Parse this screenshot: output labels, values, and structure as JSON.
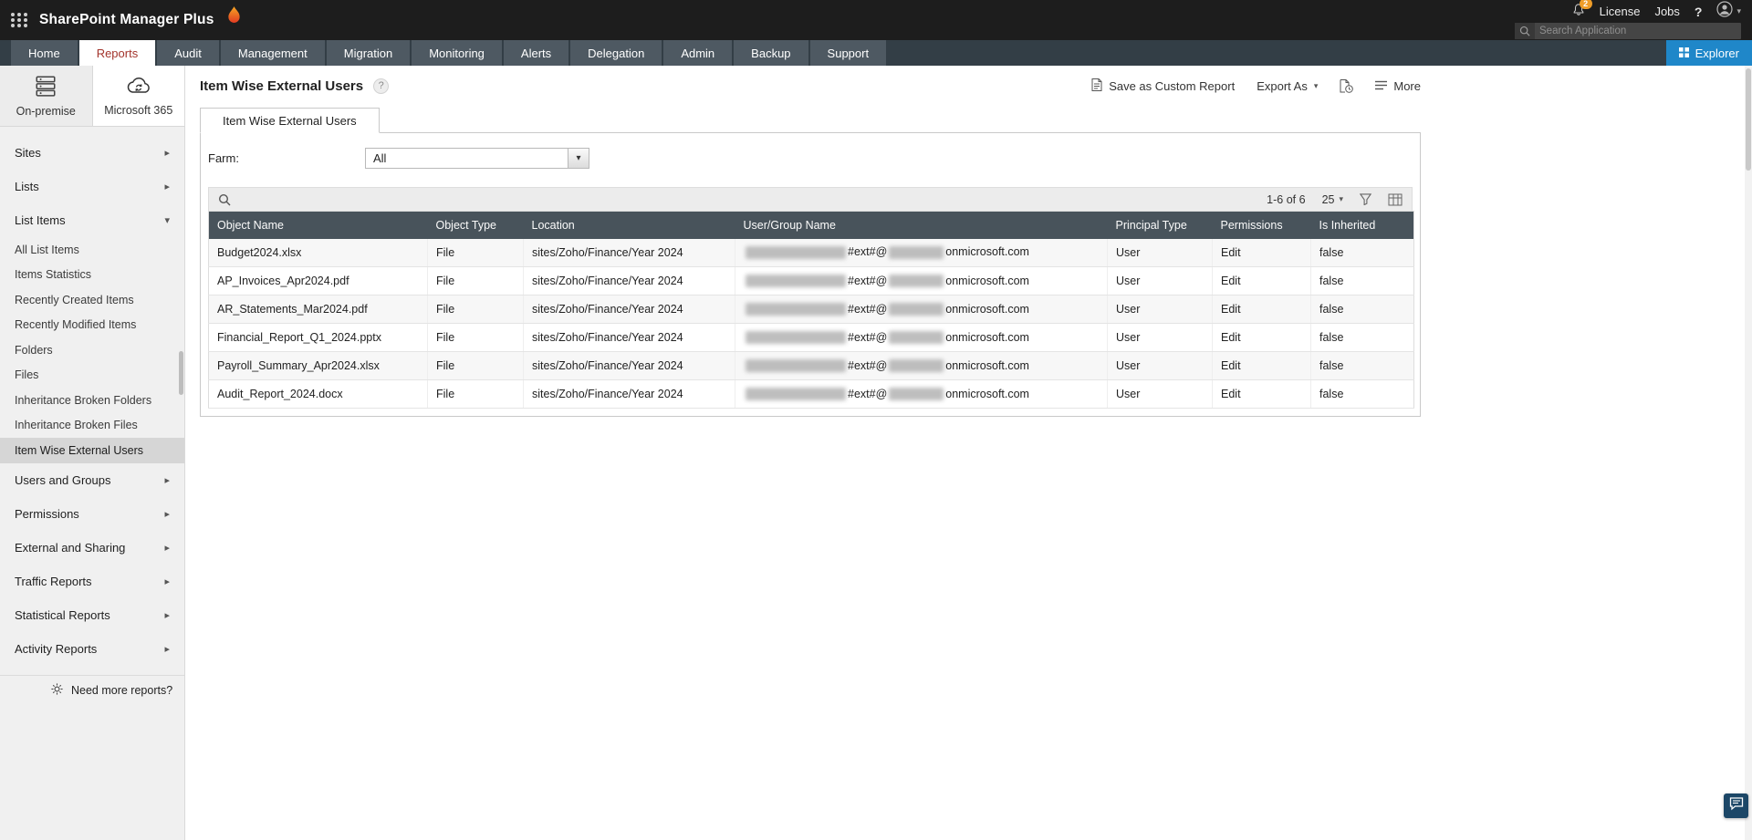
{
  "colors": {
    "topbar_bg": "#1d1d1d",
    "navbar_bg": "#333e46",
    "active_tab_red": "#a3342c",
    "explorer_blue": "#1f87c9",
    "table_header_slate": "#48535b",
    "badge_orange": "#ef9d28",
    "sidebar_bg": "#f0f0f0"
  },
  "topbar": {
    "product_name": "SharePoint Manager Plus",
    "notification_count": "2",
    "license_label": "License",
    "jobs_label": "Jobs",
    "help_label": "?",
    "search_placeholder": "Search Application"
  },
  "nav": {
    "tabs": [
      {
        "name": "tab-home",
        "label": "Home"
      },
      {
        "name": "tab-reports",
        "label": "Reports",
        "state": "active"
      },
      {
        "name": "tab-audit",
        "label": "Audit"
      },
      {
        "name": "tab-management",
        "label": "Management"
      },
      {
        "name": "tab-migration",
        "label": "Migration"
      },
      {
        "name": "tab-monitoring",
        "label": "Monitoring"
      },
      {
        "name": "tab-alerts",
        "label": "Alerts"
      },
      {
        "name": "tab-delegation",
        "label": "Delegation"
      },
      {
        "name": "tab-admin",
        "label": "Admin"
      },
      {
        "name": "tab-backup",
        "label": "Backup"
      },
      {
        "name": "tab-support",
        "label": "Support"
      }
    ],
    "explorer_label": "Explorer"
  },
  "sidebar": {
    "sources": [
      {
        "label": "On-premise"
      },
      {
        "label": "Microsoft 365"
      }
    ],
    "items": [
      {
        "name": "sidebar-item-sites",
        "type": "section",
        "label": "Sites",
        "caret": "▸"
      },
      {
        "name": "sidebar-item-lists",
        "type": "section",
        "label": "Lists",
        "caret": "▸"
      },
      {
        "name": "sidebar-item-list-items",
        "type": "section",
        "label": "List Items",
        "caret": "▾",
        "state": "expanded"
      },
      {
        "name": "sidebar-item-all-list-items",
        "type": "child",
        "label": "All List Items"
      },
      {
        "name": "sidebar-item-items-statistics",
        "type": "child",
        "label": "Items Statistics"
      },
      {
        "name": "sidebar-item-recently-created-items",
        "type": "child",
        "label": "Recently Created Items"
      },
      {
        "name": "sidebar-item-recently-modified-items",
        "type": "child",
        "label": "Recently Modified Items"
      },
      {
        "name": "sidebar-item-folders",
        "type": "child",
        "label": "Folders"
      },
      {
        "name": "sidebar-item-files",
        "type": "child",
        "label": "Files"
      },
      {
        "name": "sidebar-item-inheritance-broken-folders",
        "type": "child",
        "label": "Inheritance Broken Folders"
      },
      {
        "name": "sidebar-item-inheritance-broken-files",
        "type": "child",
        "label": "Inheritance Broken Files"
      },
      {
        "name": "sidebar-item-item-wise-external-users",
        "type": "child",
        "label": "Item Wise External Users",
        "state": "selected"
      },
      {
        "name": "sidebar-item-users-and-groups",
        "type": "section",
        "label": "Users and Groups",
        "caret": "▸"
      },
      {
        "name": "sidebar-item-permissions",
        "type": "section",
        "label": "Permissions",
        "caret": "▸"
      },
      {
        "name": "sidebar-item-external-and-sharing",
        "type": "section",
        "label": "External and Sharing",
        "caret": "▸"
      },
      {
        "name": "sidebar-item-traffic-reports",
        "type": "section",
        "label": "Traffic Reports",
        "caret": "▸"
      },
      {
        "name": "sidebar-item-statistical-reports",
        "type": "section",
        "label": "Statistical Reports",
        "caret": "▸"
      },
      {
        "name": "sidebar-item-activity-reports",
        "type": "section",
        "label": "Activity Reports",
        "caret": "▸"
      }
    ],
    "footer_label": "Need more reports?"
  },
  "content": {
    "title": "Item Wise External Users",
    "actions": {
      "save_as_custom_report": "Save as Custom Report",
      "export_as": "Export As",
      "more": "More"
    },
    "tab_label": "Item Wise External Users",
    "farm": {
      "label": "Farm:",
      "value": "All"
    },
    "toolbar": {
      "range": "1-6 of 6",
      "page_size": "25"
    },
    "table": {
      "columns": [
        "Object Name",
        "Object Type",
        "Location",
        "User/Group Name",
        "Principal Type",
        "Permissions",
        "Is Inherited"
      ],
      "rows": [
        {
          "object_name": "Budget2024.xlsx",
          "object_type": "File",
          "location": "sites/Zoho/Finance/Year 2024",
          "ext": "#ext#@",
          "domain": "onmicrosoft.com",
          "principal_type": "User",
          "permissions": "Edit",
          "is_inherited": "false"
        },
        {
          "object_name": "AP_Invoices_Apr2024.pdf",
          "object_type": "File",
          "location": "sites/Zoho/Finance/Year 2024",
          "ext": "#ext#@",
          "domain": "onmicrosoft.com",
          "principal_type": "User",
          "permissions": "Edit",
          "is_inherited": "false"
        },
        {
          "object_name": "AR_Statements_Mar2024.pdf",
          "object_type": "File",
          "location": "sites/Zoho/Finance/Year 2024",
          "ext": "#ext#@",
          "domain": "onmicrosoft.com",
          "principal_type": "User",
          "permissions": "Edit",
          "is_inherited": "false"
        },
        {
          "object_name": "Financial_Report_Q1_2024.pptx",
          "object_type": "File",
          "location": "sites/Zoho/Finance/Year 2024",
          "ext": "#ext#@",
          "domain": "onmicrosoft.com",
          "principal_type": "User",
          "permissions": "Edit",
          "is_inherited": "false"
        },
        {
          "object_name": "Payroll_Summary_Apr2024.xlsx",
          "object_type": "File",
          "location": "sites/Zoho/Finance/Year 2024",
          "ext": "#ext#@",
          "domain": "onmicrosoft.com",
          "principal_type": "User",
          "permissions": "Edit",
          "is_inherited": "false"
        },
        {
          "object_name": "Audit_Report_2024.docx",
          "object_type": "File",
          "location": "sites/Zoho/Finance/Year 2024",
          "ext": "#ext#@",
          "domain": "onmicrosoft.com",
          "principal_type": "User",
          "permissions": "Edit",
          "is_inherited": "false"
        }
      ]
    }
  }
}
